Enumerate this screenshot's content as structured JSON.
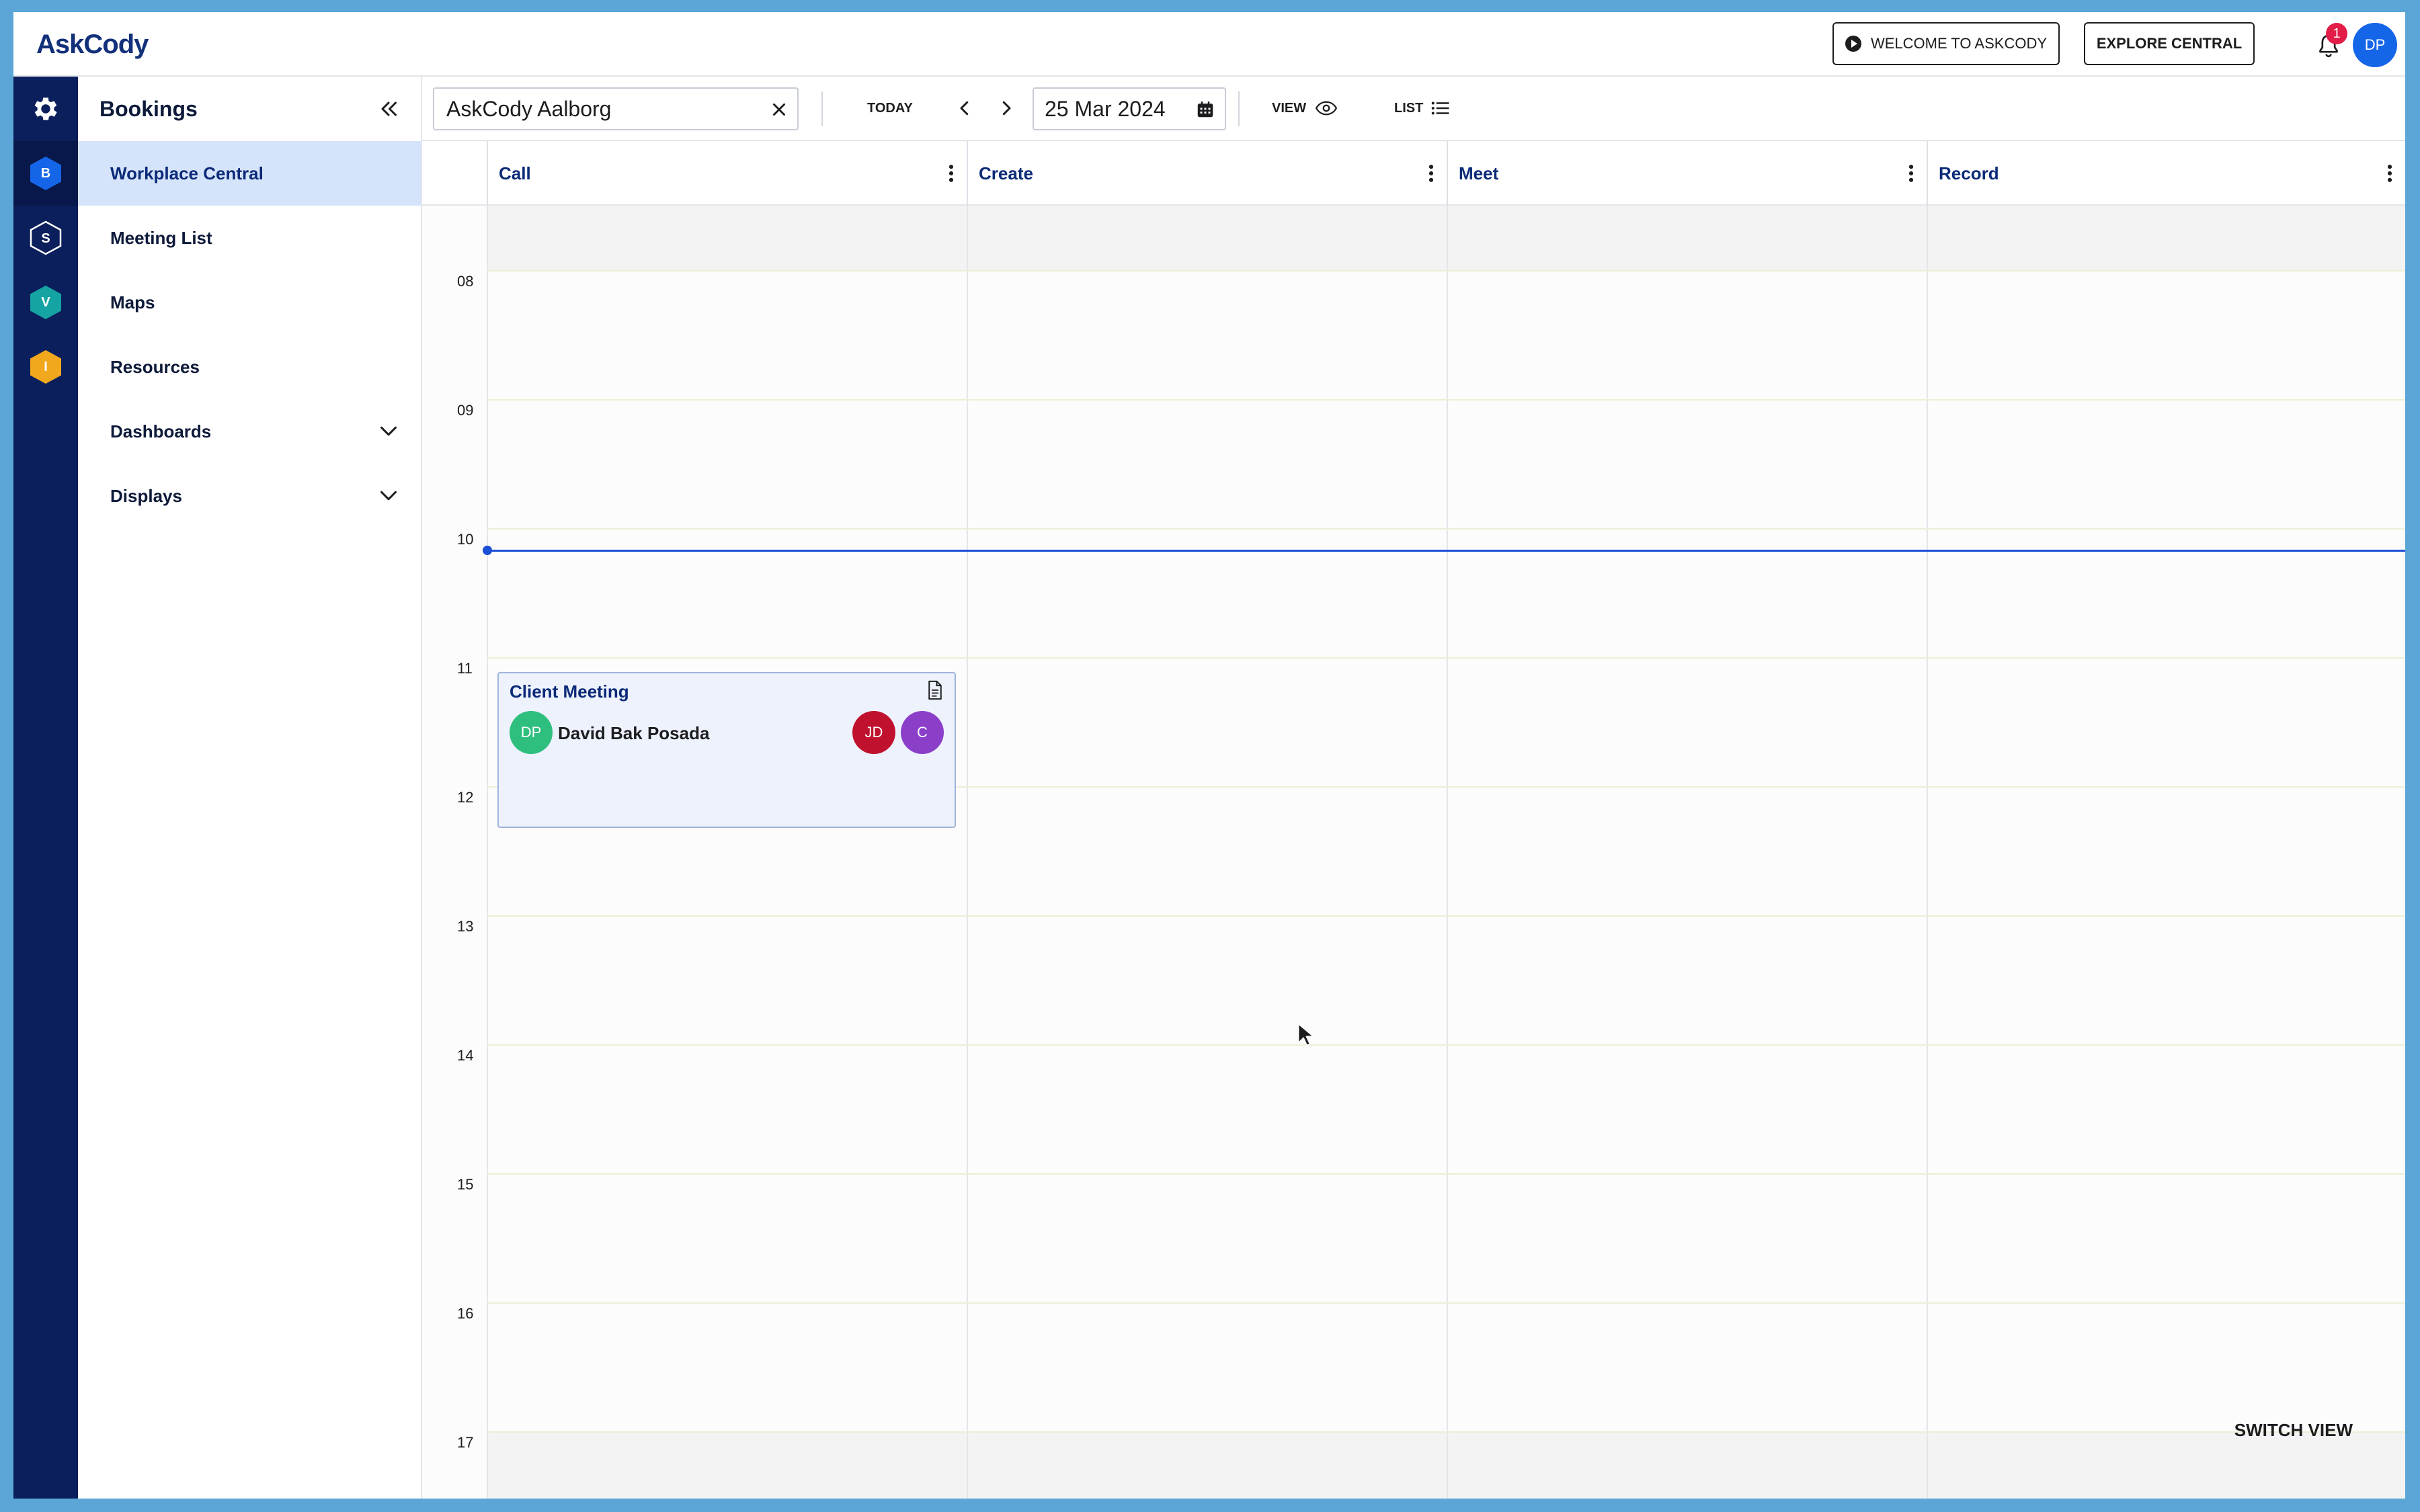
{
  "app": {
    "logo": "AskCody"
  },
  "header": {
    "welcome_label": "WELCOME TO ASKCODY",
    "explore_label": "EXPLORE CENTRAL",
    "notification_count": "1",
    "user_initials": "DP"
  },
  "rail": {
    "items": [
      {
        "icon": "gear-icon"
      },
      {
        "letter": "B",
        "color": "#1565e8"
      },
      {
        "letter": "S",
        "color": "#0b1f5c"
      },
      {
        "letter": "V",
        "color": "#16a3a3"
      },
      {
        "letter": "I",
        "color": "#f2a81d"
      }
    ]
  },
  "sidebar": {
    "title": "Bookings",
    "items": [
      {
        "label": "Workplace Central",
        "active": true
      },
      {
        "label": "Meeting List"
      },
      {
        "label": "Maps"
      },
      {
        "label": "Resources"
      },
      {
        "label": "Dashboards",
        "expandable": true
      },
      {
        "label": "Displays",
        "expandable": true
      }
    ]
  },
  "toolbar": {
    "location_value": "AskCody Aalborg",
    "today_label": "TODAY",
    "date_value": "25 Mar 2024",
    "view_label": "VIEW",
    "list_label": "LIST"
  },
  "calendar": {
    "columns": [
      "Call",
      "Create",
      "Meet",
      "Record"
    ],
    "hours": [
      "08",
      "09",
      "10",
      "11",
      "12",
      "13",
      "14",
      "15",
      "16",
      "17"
    ],
    "event": {
      "title": "Client Meeting",
      "organizer_initials": "DP",
      "organizer_name": "David Bak Posada",
      "attendees": [
        {
          "initials": "JD",
          "color": "#c0122e"
        },
        {
          "initials": "C",
          "color": "#8b3fc9"
        }
      ],
      "organizer_color": "#2ebf7f"
    },
    "switch_view_label": "SWITCH VIEW"
  }
}
